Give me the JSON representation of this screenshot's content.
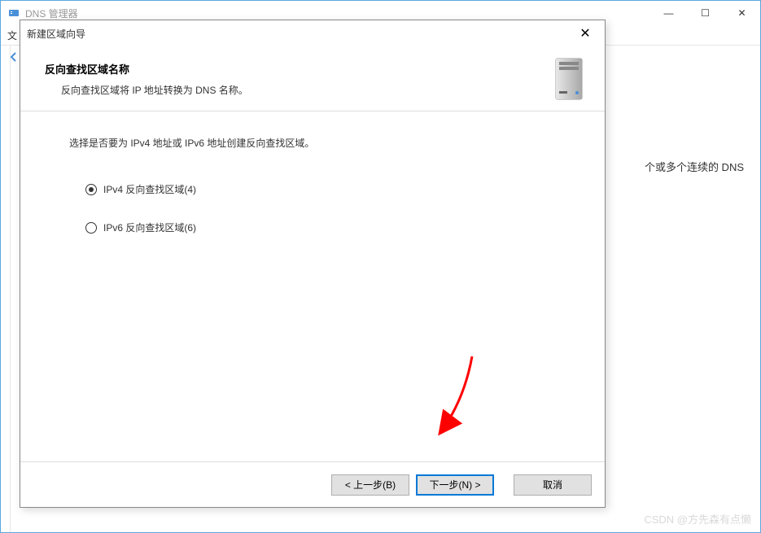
{
  "parent": {
    "title": "DNS 管理器",
    "menu_hint": "文",
    "right_panel_text": "个或多个连续的 DNS",
    "controls": {
      "min": "—",
      "max": "☐",
      "close": "✕"
    }
  },
  "dialog": {
    "title": "新建区域向导",
    "close": "✕",
    "heading": "反向查找区域名称",
    "subheading": "反向查找区域将 IP 地址转换为 DNS 名称。",
    "prompt": "选择是否要为 IPv4 地址或 IPv6 地址创建反向查找区域。",
    "radios": [
      {
        "label": "IPv4 反向查找区域(4)",
        "selected": true
      },
      {
        "label": "IPv6 反向查找区域(6)",
        "selected": false
      }
    ],
    "buttons": {
      "back": "< 上一步(B)",
      "next": "下一步(N) >",
      "cancel": "取消"
    }
  },
  "watermark": "CSDN @方先森有点懒"
}
